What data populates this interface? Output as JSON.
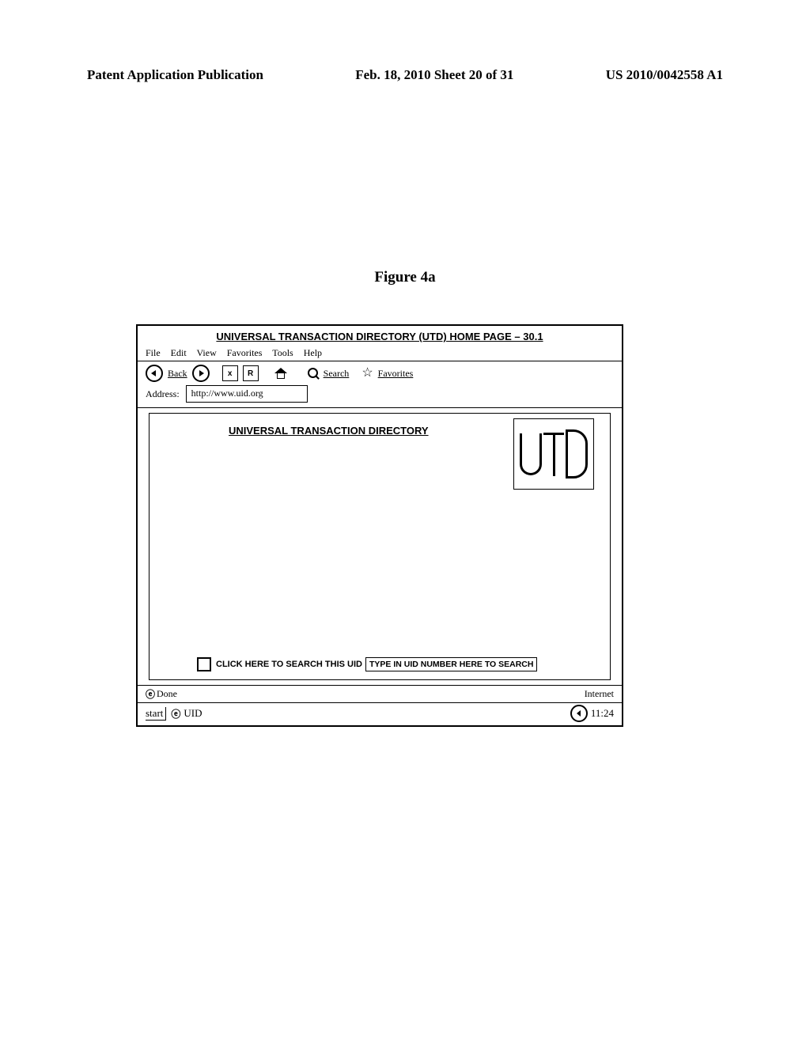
{
  "header": {
    "left": "Patent Application Publication",
    "center": "Feb. 18, 2010  Sheet 20 of 31",
    "right": "US 2010/0042558 A1"
  },
  "figure_label": "Figure 4a",
  "browser": {
    "title": "UNIVERSAL TRANSACTION DIRECTORY (UTD) HOME PAGE – 30.1",
    "menu": [
      "File",
      "Edit",
      "View",
      "Favorites",
      "Tools",
      "Help"
    ],
    "toolbar": {
      "back_label": "Back",
      "stop_label": "x",
      "refresh_label": "R",
      "search_label": "Search",
      "favorites_label": "Favorites"
    },
    "address_label": "Address:",
    "address_value": "http://www.uid.org",
    "content": {
      "page_heading": "UNIVERSAL TRANSACTION DIRECTORY",
      "logo_text": "UTD",
      "search_prompt": "CLICK HERE TO SEARCH THIS UID",
      "search_placeholder": "TYPE IN UID NUMBER HERE TO SEARCH"
    },
    "status": {
      "done": "Done",
      "zone": "Internet"
    },
    "taskbar": {
      "start": "start",
      "app": "UID",
      "time": "11:24"
    }
  }
}
